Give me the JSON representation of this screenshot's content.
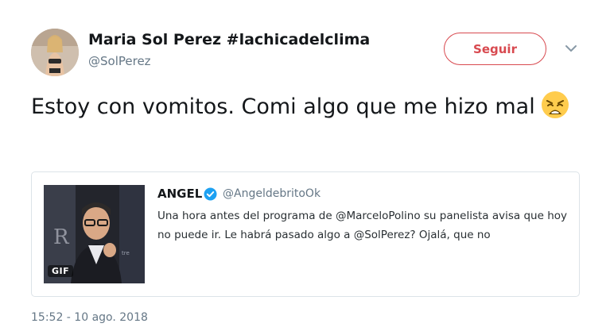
{
  "tweet": {
    "author": {
      "display_name": "Maria Sol Perez #lachicadelclima",
      "handle": "@SolPerez"
    },
    "follow_label": "Seguir",
    "text": "Estoy con vomitos. Comi algo que me hizo mal",
    "emoji": "weary-face-icon",
    "timestamp": "15:52 - 10 ago. 2018"
  },
  "quoted_tweet": {
    "author": {
      "display_name": "ANGEL",
      "handle": "@AngeldebritoOk",
      "verified": true
    },
    "text": "Una hora antes del programa de @MarceloPolino su panelista avisa que hoy no puede ir.  Le habrá pasado algo a @SolPerez? Ojalá, que no",
    "media_badge": "GIF"
  },
  "colors": {
    "follow_accent": "#d8494f",
    "secondary_text": "#657786",
    "verified_blue": "#1da1f2"
  }
}
